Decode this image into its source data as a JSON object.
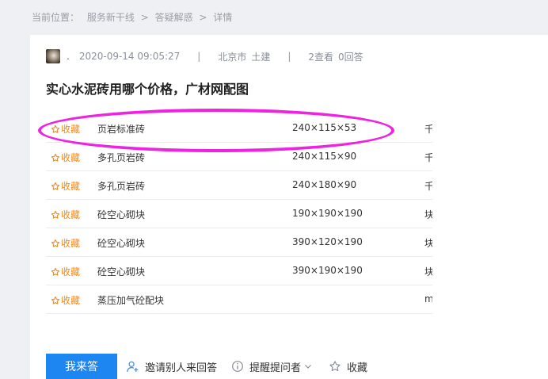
{
  "breadcrumb": {
    "label": "当前位置：",
    "items": [
      "服务新干线",
      "答疑解惑",
      "详情"
    ],
    "sep": ">"
  },
  "question": {
    "user": ".",
    "datetime": "2020-09-14 09:05:27",
    "location": "北京市",
    "category": "土建",
    "views": "2查看",
    "answers": "0回答",
    "title": "实心水泥砖用哪个价格，广材网配图"
  },
  "table": {
    "fav_label": "收藏",
    "rows": [
      {
        "name": "页岩标准砖",
        "spec": "240×115×53",
        "extra": "千"
      },
      {
        "name": "多孔页岩砖",
        "spec": "240×115×90",
        "extra": "千"
      },
      {
        "name": "多孔页岩砖",
        "spec": "240×180×90",
        "extra": "千"
      },
      {
        "name": "砼空心砌块",
        "spec": "190×190×190",
        "extra": "块"
      },
      {
        "name": "砼空心砌块",
        "spec": "390×120×190",
        "extra": "块"
      },
      {
        "name": "砼空心砌块",
        "spec": "390×190×190",
        "extra": "块"
      },
      {
        "name": "蒸压加气砼配块",
        "spec": "",
        "extra": "m"
      }
    ]
  },
  "actions": {
    "answer": "我来答",
    "invite": "邀请别人来回答",
    "remind": "提醒提问者",
    "collect": "收藏"
  },
  "colors": {
    "accent": "#1d86f0",
    "favorite": "#f38a1d",
    "highlight": "#ee22e0"
  }
}
